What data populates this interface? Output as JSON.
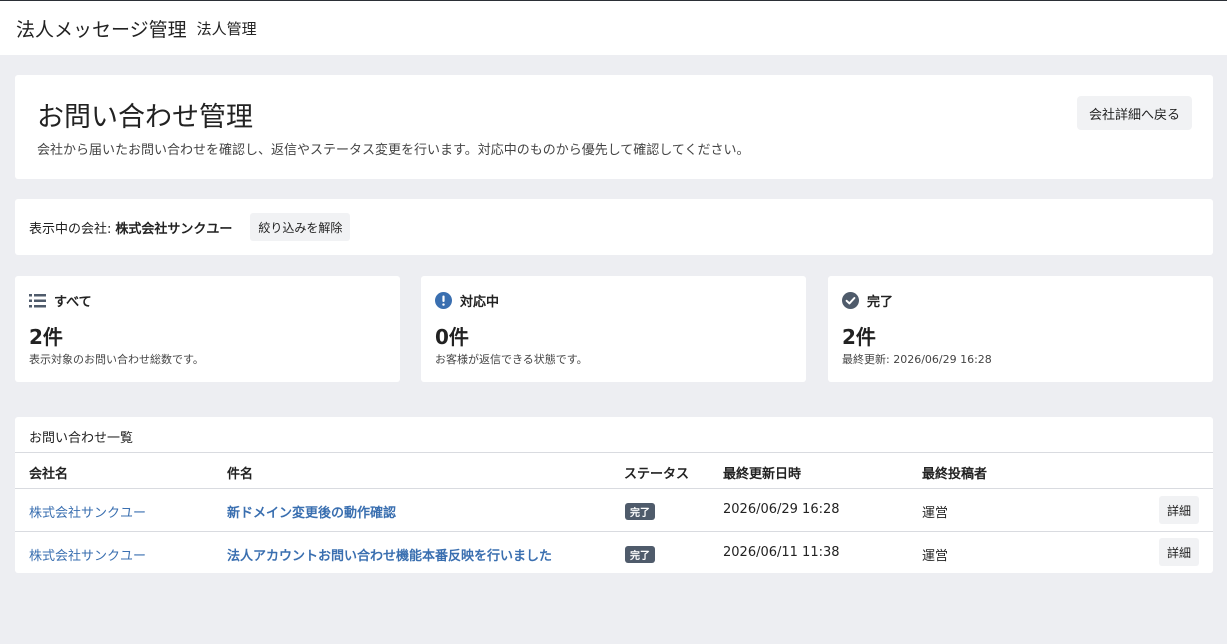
{
  "app": {
    "title": "法人メッセージ管理",
    "subtitle": "法人管理"
  },
  "header": {
    "title": "お問い合わせ管理",
    "description": "会社から届いたお問い合わせを確認し、返信やステータス変更を行います。対応中のものから優先して確認してください。",
    "back_label": "会社詳細へ戻る"
  },
  "filter": {
    "label": "表示中の会社:",
    "company": "株式会社サンクユー",
    "clear_label": "絞り込みを解除"
  },
  "stats": [
    {
      "label": "すべて",
      "count": "2件",
      "note": "表示対象のお問い合わせ総数です。",
      "icon": "list-icon"
    },
    {
      "label": "対応中",
      "count": "0件",
      "note": "お客様が返信できる状態です。",
      "icon": "exclamation-circle-icon",
      "color": "#3a6fb0"
    },
    {
      "label": "完了",
      "count": "2件",
      "note": "最終更新: 2026/06/29 16:28",
      "icon": "check-circle-icon",
      "color": "#4f5b6b"
    }
  ],
  "list": {
    "title": "お問い合わせ一覧",
    "columns": [
      "会社名",
      "件名",
      "ステータス",
      "最終更新日時",
      "最終投稿者"
    ],
    "rows": [
      {
        "company": "株式会社サンクユー",
        "subject": "新ドメイン変更後の動作確認",
        "status": "完了",
        "updated": "2026/06/29 16:28",
        "poster": "運営",
        "action": "詳細"
      },
      {
        "company": "株式会社サンクユー",
        "subject": "法人アカウントお問い合わせ機能本番反映を行いました",
        "status": "完了",
        "updated": "2026/06/11 11:38",
        "poster": "運営",
        "action": "詳細"
      }
    ]
  }
}
